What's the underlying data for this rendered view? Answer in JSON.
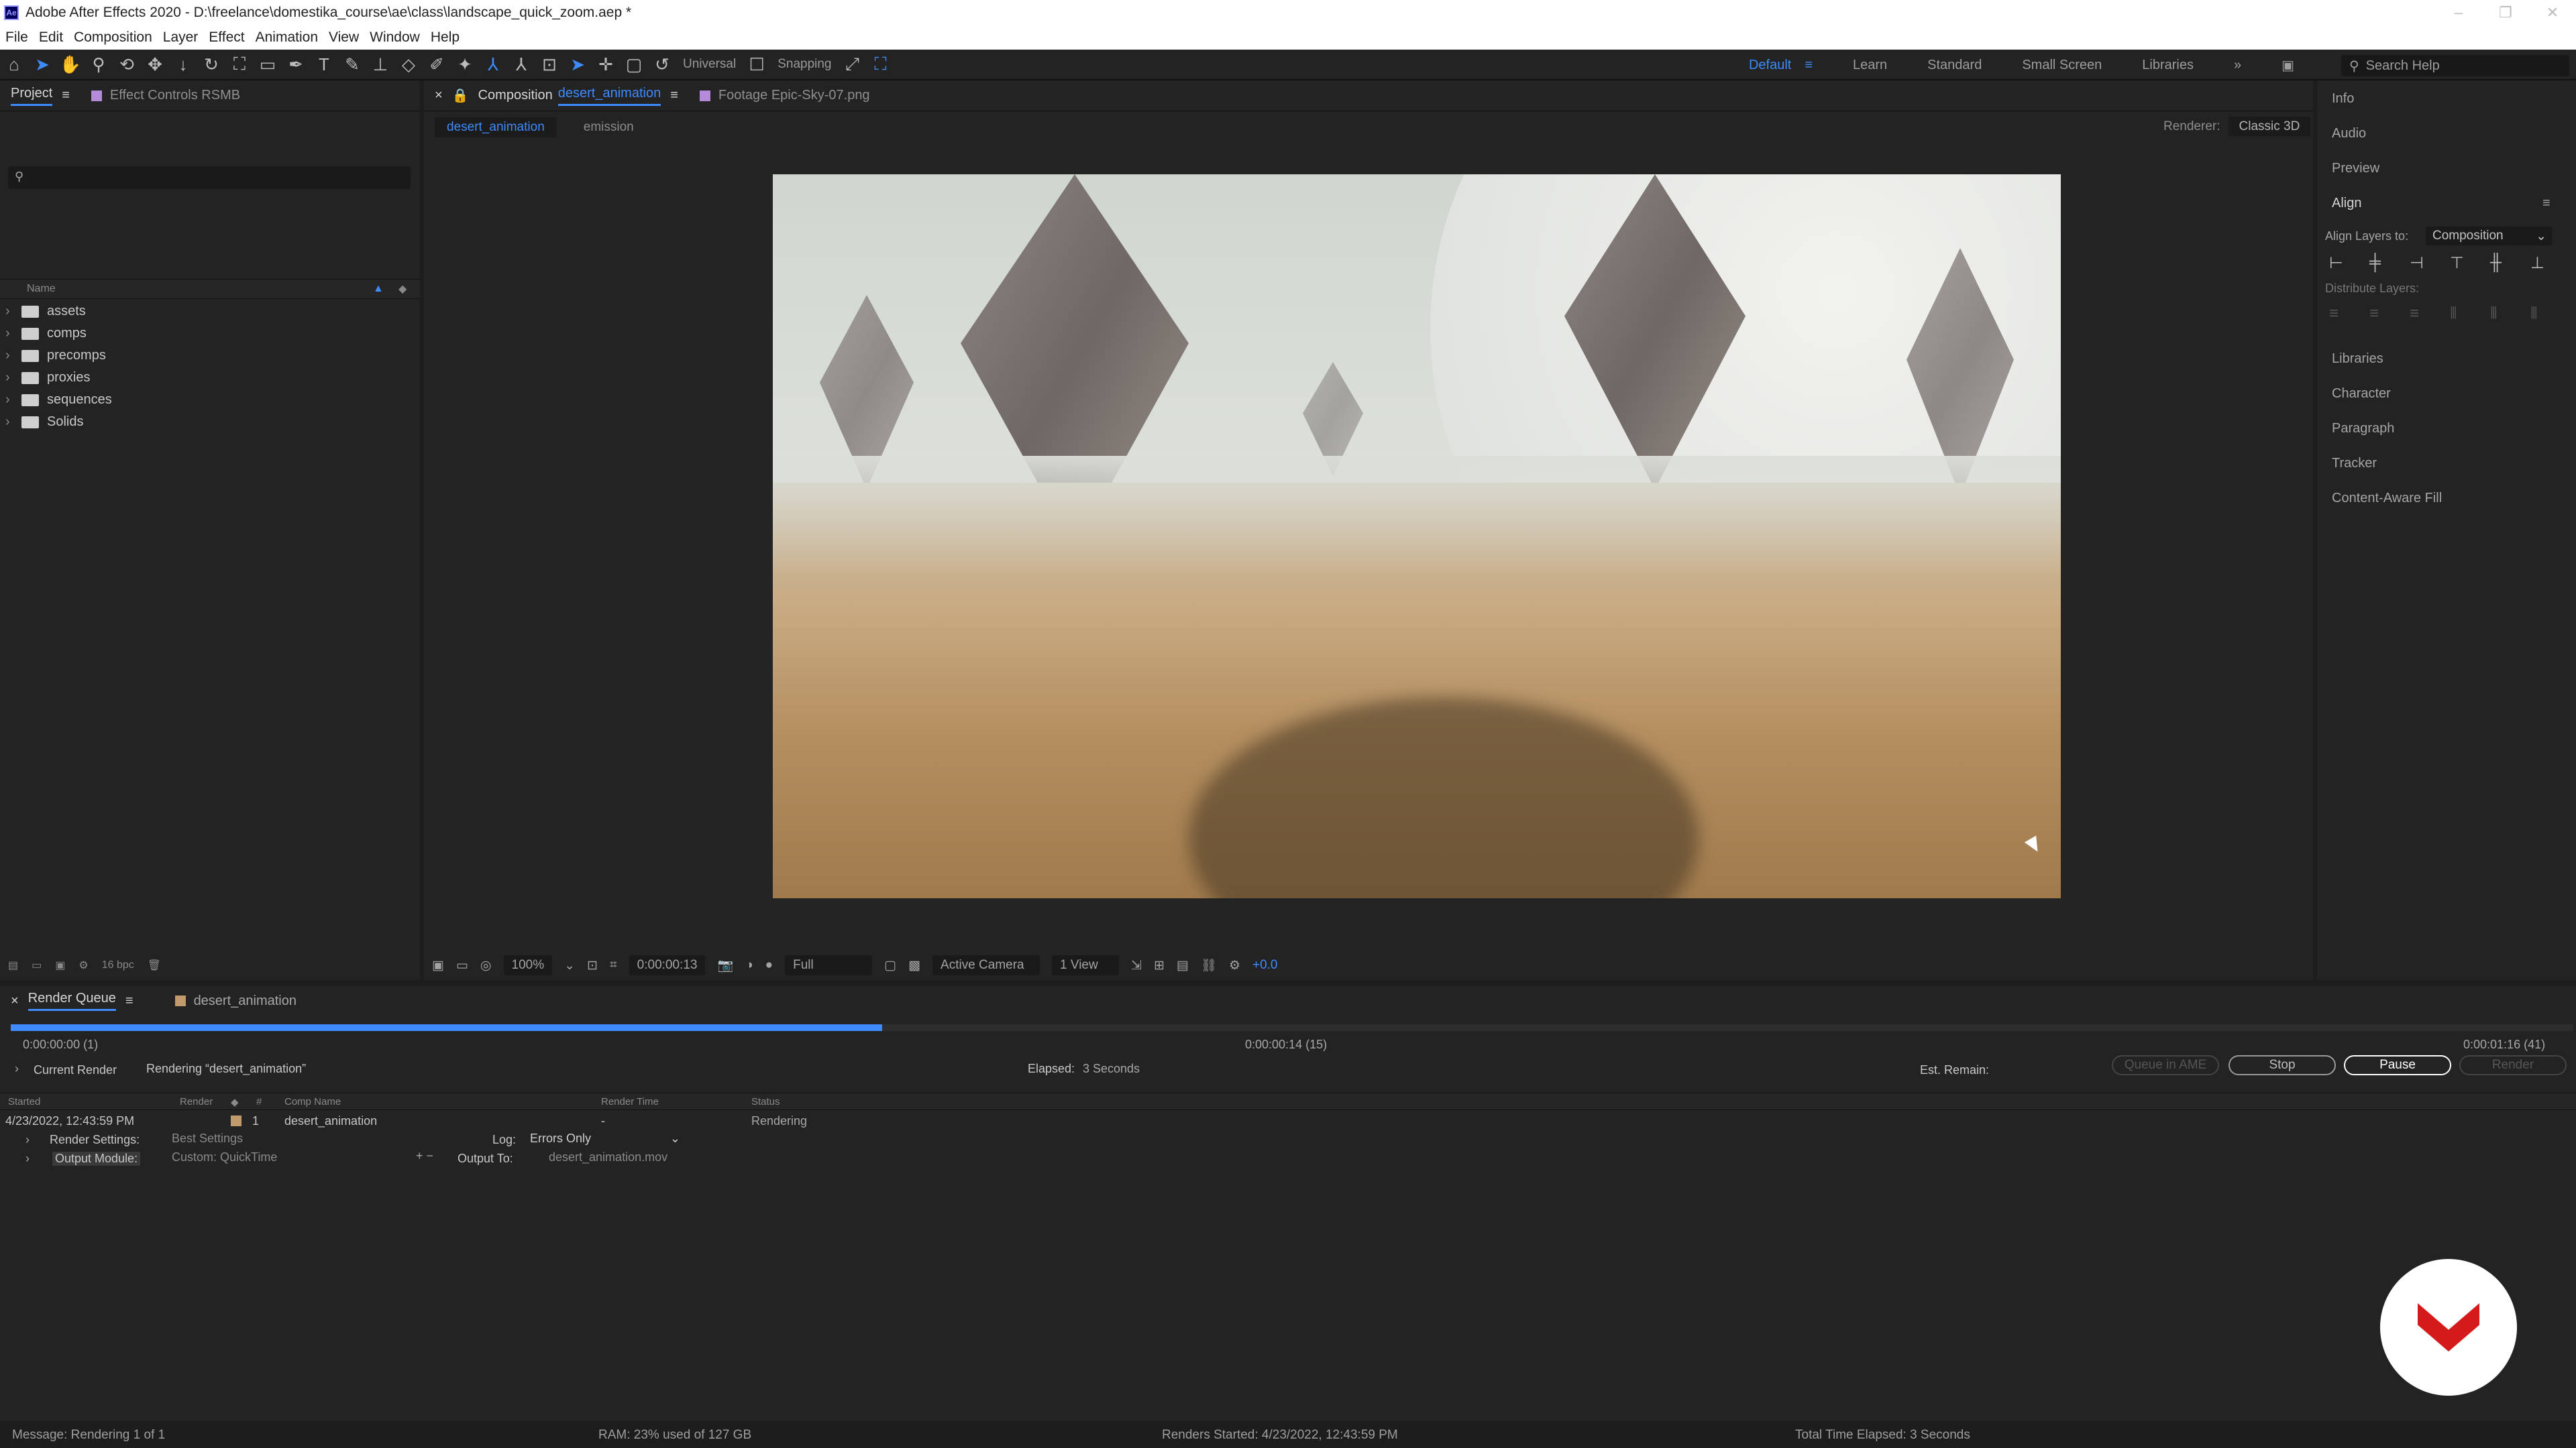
{
  "window": {
    "title": "Adobe After Effects 2020 - D:\\freelance\\domestika_course\\ae\\class\\landscape_quick_zoom.aep *",
    "app_icon_text": "Ae",
    "minimize": "–",
    "restore": "❐",
    "close": "✕"
  },
  "menu": [
    "File",
    "Edit",
    "Composition",
    "Layer",
    "Effect",
    "Animation",
    "View",
    "Window",
    "Help"
  ],
  "toolbar": {
    "universal_label": "Universal",
    "snapping_label": "Snapping",
    "workspaces": [
      "Default",
      "Learn",
      "Standard",
      "Small Screen",
      "Libraries"
    ],
    "active_workspace": "Default",
    "search_placeholder": "Search Help"
  },
  "project_panel": {
    "tabs": [
      "Project",
      "Effect Controls RSMB"
    ],
    "column_name": "Name",
    "items": [
      "assets",
      "comps",
      "precomps",
      "proxies",
      "sequences",
      "Solids"
    ],
    "bpc_label": "16 bpc"
  },
  "composition_panel": {
    "tab_prefix": "Composition",
    "tab_comp": "desert_animation",
    "footage_tab": "Footage  Epic-Sky-07.png",
    "subtabs": [
      "desert_animation",
      "emission"
    ],
    "renderer_label": "Renderer:",
    "renderer_value": "Classic 3D",
    "footer": {
      "zoom": "100%",
      "timecode": "0:00:00:13",
      "resolution": "Full",
      "camera": "Active Camera",
      "views": "1 View",
      "exposure": "+0.0"
    }
  },
  "right_panel": {
    "items": [
      "Info",
      "Audio",
      "Preview",
      "Align",
      "Libraries",
      "Character",
      "Paragraph",
      "Tracker",
      "Content-Aware Fill"
    ],
    "align_layers_to_label": "Align Layers to:",
    "align_layers_to_value": "Composition",
    "distribute_label": "Distribute Layers:"
  },
  "render_queue": {
    "tabs": [
      "Render Queue",
      "desert_animation"
    ],
    "progress": 0.34,
    "time_start": "0:00:00:00 (1)",
    "time_mid": "0:00:00:14 (15)",
    "time_end": "0:00:01:16 (41)",
    "current_render_label": "Current Render",
    "rendering_text": "Rendering “desert_animation”",
    "elapsed_label": "Elapsed:",
    "elapsed_value": "3 Seconds",
    "est_remain_label": "Est. Remain:",
    "buttons": {
      "queue_ame": "Queue in AME",
      "stop": "Stop",
      "pause": "Pause",
      "render": "Render"
    },
    "columns": [
      "Started",
      "Render",
      "#",
      "Comp Name",
      "Render Time",
      "Status"
    ],
    "row": {
      "started": "4/23/2022, 12:43:59 PM",
      "index": "1",
      "comp_name": "desert_animation",
      "render_time": "-",
      "status": "Rendering"
    },
    "render_settings_label": "Render Settings:",
    "render_settings_value": "Best Settings",
    "log_label": "Log:",
    "log_value": "Errors Only",
    "output_module_label": "Output Module:",
    "output_module_value": "Custom: QuickTime",
    "output_to_label": "Output To:",
    "output_to_value": "desert_animation.mov"
  },
  "status_bar": {
    "message": "Message:  Rendering 1 of 1",
    "ram": "RAM:  23% used of 127 GB",
    "renders_started": "Renders Started:  4/23/2022, 12:43:59 PM",
    "total_elapsed": "Total Time Elapsed:  3 Seconds"
  }
}
